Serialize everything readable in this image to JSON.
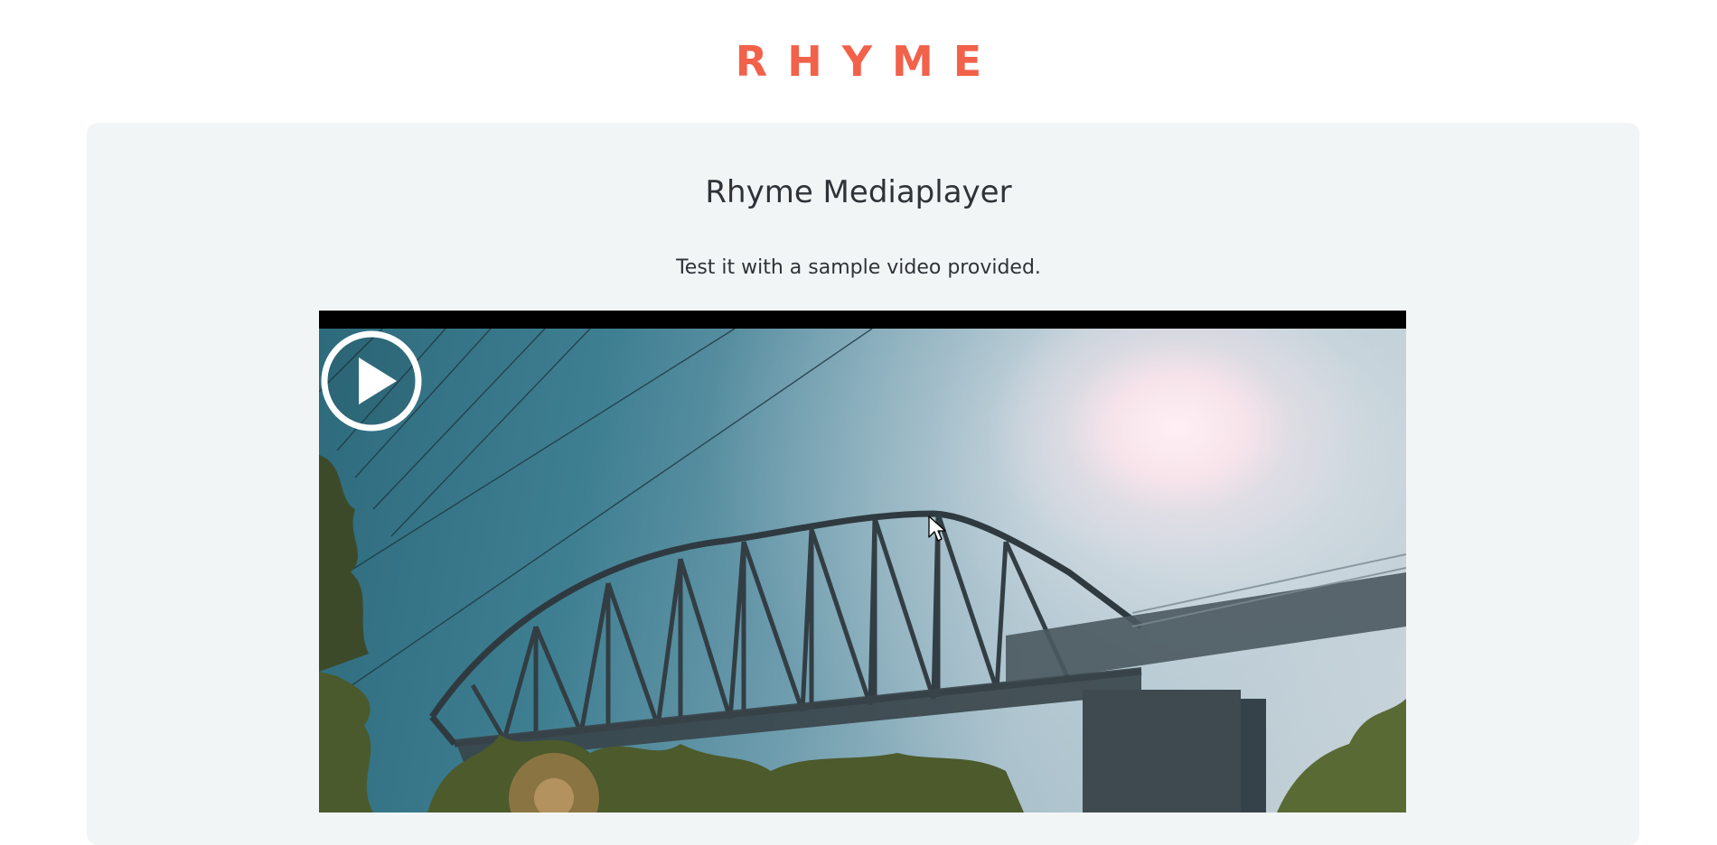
{
  "header": {
    "logo_text": "RHYME",
    "brand_color": "#f2614a"
  },
  "main": {
    "title": "Rhyme Mediaplayer",
    "subtitle": "Test it with a sample video provided."
  },
  "player": {
    "play_icon": "play-circle-icon",
    "state": "paused"
  },
  "colors": {
    "panel_background": "#f2f5f6",
    "text": "#2f3338"
  }
}
